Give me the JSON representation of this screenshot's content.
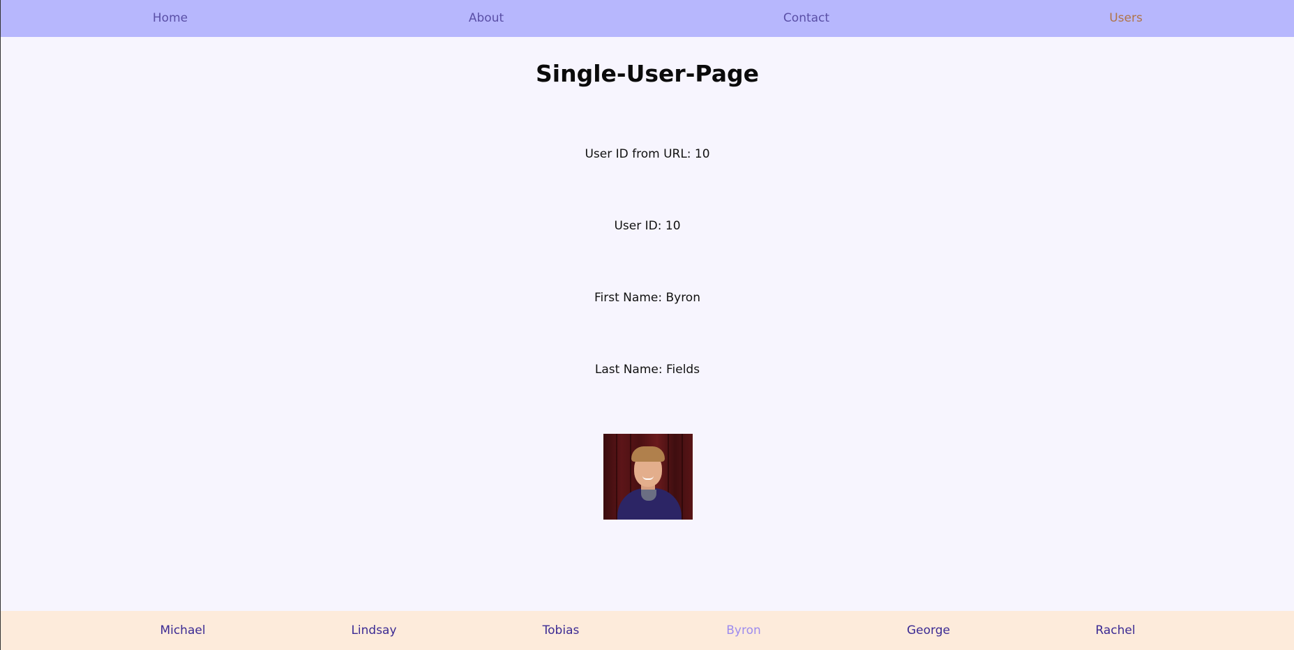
{
  "topnav": {
    "items": [
      {
        "label": "Home"
      },
      {
        "label": "About"
      },
      {
        "label": "Contact"
      },
      {
        "label": "Users",
        "active": true
      }
    ]
  },
  "page": {
    "title": "Single-User-Page",
    "user_id_from_url": "User ID from URL: 10",
    "user_id": "User ID: 10",
    "first_name": "First Name: Byron",
    "last_name": "Last Name: Fields",
    "photo": "user-photo"
  },
  "bottomnav": {
    "users": [
      {
        "label": "Michael"
      },
      {
        "label": "Lindsay"
      },
      {
        "label": "Tobias"
      },
      {
        "label": "Byron",
        "active": true
      },
      {
        "label": "George"
      },
      {
        "label": "Rachel"
      }
    ]
  },
  "colors": {
    "topnav_bg": "#b7b7fd",
    "active_top": "#b07448",
    "bottomnav_bg": "#fdebdb",
    "active_bottom": "#9d8bee",
    "page_bg": "#f7f5fe"
  }
}
